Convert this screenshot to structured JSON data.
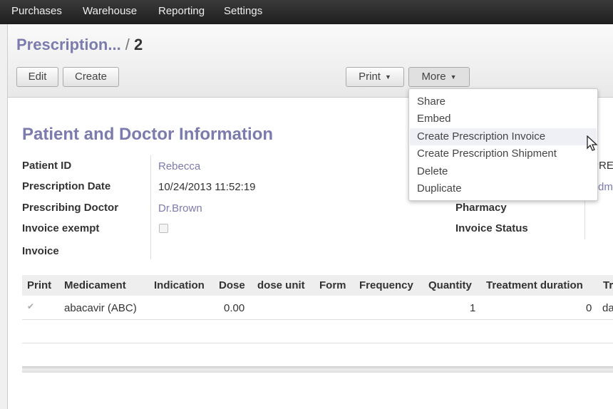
{
  "nav": {
    "items": [
      "Purchases",
      "Warehouse",
      "Reporting",
      "Settings"
    ]
  },
  "header": {
    "breadcrumb_parent": "Prescription...",
    "separator": "/",
    "record": "2",
    "edit": "Edit",
    "create": "Create",
    "print": "Print",
    "more": "More"
  },
  "more_menu": {
    "items": [
      "Share",
      "Embed",
      "Create Prescription Invoice",
      "Create Prescription Shipment",
      "Delete",
      "Duplicate"
    ],
    "hovered": "Create Prescription Invoice"
  },
  "form": {
    "section_title": "Patient and Doctor Information",
    "patient_id_label": "Patient ID",
    "patient_id": "Rebecca",
    "date_label": "Prescription Date",
    "date": "10/24/2013 11:52:19",
    "doctor_label": "Prescribing Doctor",
    "doctor": "Dr.Brown",
    "exempt_label": "Invoice exempt",
    "exempt": false,
    "invoice_label": "Invoice",
    "pharmacy_label": "Pharmacy",
    "invoice_status_label": "Invoice Status",
    "right_partial_1": "PRE",
    "right_partial_2": "Adm"
  },
  "table": {
    "columns": [
      "Print",
      "Medicament",
      "Indication",
      "Dose",
      "dose unit",
      "Form",
      "Frequency",
      "Quantity",
      "Treatment duration",
      "Tr"
    ],
    "rows": [
      {
        "print": true,
        "medicament": "abacavir (ABC)",
        "dose": "0.00",
        "quantity": "1",
        "duration": "0",
        "tr": "da"
      }
    ]
  }
}
